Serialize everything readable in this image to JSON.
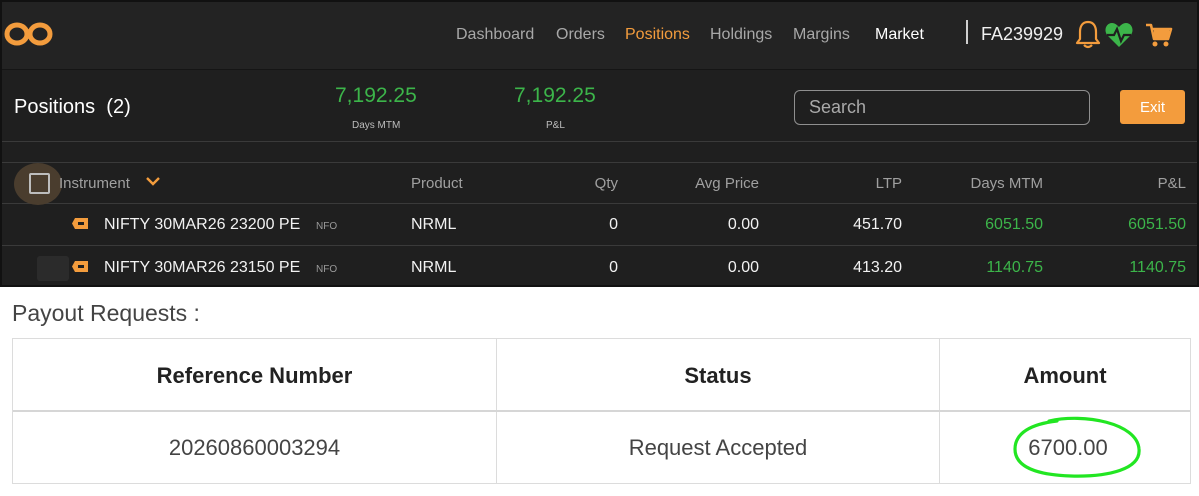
{
  "colors": {
    "accent": "#f39c3d",
    "positive": "#3cb54a",
    "panel_bg": "#1f1f1f",
    "annotation": "#22e622"
  },
  "nav": {
    "items": [
      {
        "label": "Dashboard",
        "state": "normal"
      },
      {
        "label": "Orders",
        "state": "normal"
      },
      {
        "label": "Positions",
        "state": "active"
      },
      {
        "label": "Holdings",
        "state": "normal"
      },
      {
        "label": "Margins",
        "state": "normal"
      },
      {
        "label": "Market",
        "state": "bright"
      }
    ],
    "user_id": "FA239929",
    "icons": [
      "logo-icon",
      "bell-icon",
      "heartbeat-icon",
      "cart-icon"
    ]
  },
  "summary": {
    "title": "Positions",
    "count": "(2)",
    "days_mtm_value": "7,192.25",
    "days_mtm_label": "Days MTM",
    "pnl_value": "7,192.25",
    "pnl_label": "P&L",
    "search_placeholder": "Search",
    "exit_label": "Exit"
  },
  "positions": {
    "columns": [
      "Instrument",
      "Product",
      "Qty",
      "Avg Price",
      "LTP",
      "Days MTM",
      "P&L"
    ],
    "rows": [
      {
        "instrument": "NIFTY 30MAR26 23200 PE",
        "exchange": "NFO",
        "product": "NRML",
        "qty": "0",
        "avg_price": "0.00",
        "ltp": "451.70",
        "days_mtm": "6051.50",
        "pnl": "6051.50"
      },
      {
        "instrument": "NIFTY 30MAR26 23150 PE",
        "exchange": "NFO",
        "product": "NRML",
        "qty": "0",
        "avg_price": "0.00",
        "ltp": "413.20",
        "days_mtm": "1140.75",
        "pnl": "1140.75"
      }
    ]
  },
  "payout": {
    "title": "Payout Requests :",
    "columns": [
      "Reference Number",
      "Status",
      "Amount"
    ],
    "rows": [
      {
        "reference": "20260860003294",
        "status": "Request Accepted",
        "amount": "6700.00"
      }
    ]
  }
}
